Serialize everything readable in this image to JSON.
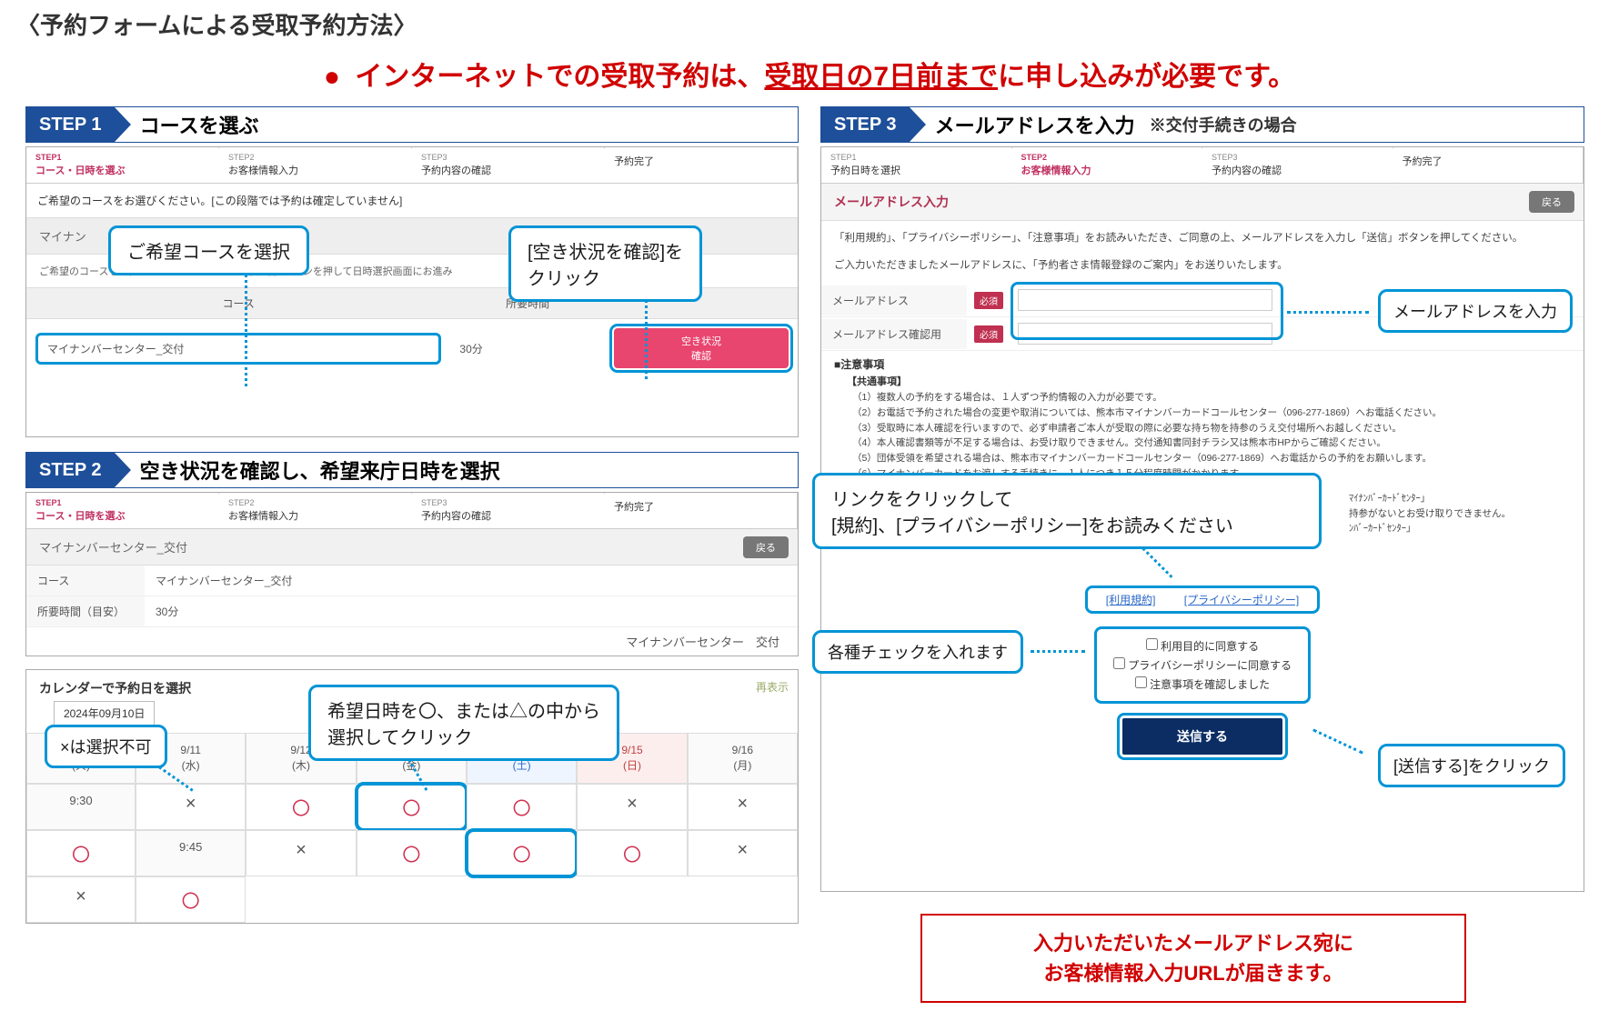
{
  "page_title": "〈予約フォームによる受取予約方法〉",
  "warning_prefix": "インターネットでの受取予約は、",
  "warning_underline": "受取日の7日前まで",
  "warning_suffix": "に申し込みが必要です。",
  "step1": {
    "badge": "STEP 1",
    "title": "コースを選ぶ",
    "crumbs": [
      {
        "small": "STEP1",
        "label": "コース・日時を選ぶ",
        "active": true
      },
      {
        "small": "STEP2",
        "label": "お客様情報入力",
        "active": false
      },
      {
        "small": "STEP3",
        "label": "予約内容の確認",
        "active": false
      },
      {
        "small": "",
        "label": "予約完了",
        "active": false
      }
    ],
    "instr": "ご希望のコースをお選びください。[この段階では予約は確定していません]",
    "tab_label": "マイナン",
    "course_instr": "ご希望のコースを選択していただき、「空き状況確認」ボタンを押して日時選択画面にお進み",
    "th_course": "コース",
    "th_time": "所要時間",
    "row_course": "マイナンバーセンター_交付",
    "row_time": "30分",
    "avail_btn_l1": "空き状況",
    "avail_btn_l2": "確認",
    "callout_course": "ご希望コースを選択",
    "callout_avail_l1": "[空き状況を確認]を",
    "callout_avail_l2": "クリック"
  },
  "step2": {
    "badge": "STEP 2",
    "title": "空き状況を確認し、希望来庁日時を選択",
    "crumbs": [
      {
        "small": "STEP1",
        "label": "コース・日時を選ぶ",
        "active": true
      },
      {
        "small": "STEP2",
        "label": "お客様情報入力",
        "active": false
      },
      {
        "small": "STEP3",
        "label": "予約内容の確認",
        "active": false
      },
      {
        "small": "",
        "label": "予約完了",
        "active": false
      }
    ],
    "subhead": "マイナンバーセンター_交付",
    "back": "戻る",
    "info_course_label": "コース",
    "info_course_value": "マイナンバーセンター_交付",
    "info_time_label": "所要時間（目安）",
    "info_time_value": "30分",
    "right_caption": "マイナンバーセンター　交付",
    "cal_title": "カレンダーで予約日を選択",
    "cal_date": "2024年09月10日",
    "redisplay": "再表示",
    "cal_head_blank": "(火)",
    "cal_heads": [
      {
        "d": "9/11",
        "w": "(水)",
        "cls": ""
      },
      {
        "d": "9/12",
        "w": "(木)",
        "cls": ""
      },
      {
        "d": "9/13",
        "w": "(金)",
        "cls": ""
      },
      {
        "d": "9/14",
        "w": "(土)",
        "cls": "sat"
      },
      {
        "d": "9/15",
        "w": "(日)",
        "cls": "sun"
      },
      {
        "d": "9/16",
        "w": "(月)",
        "cls": ""
      }
    ],
    "cal_times": [
      "9:30",
      "9:45"
    ],
    "cal_slots": [
      [
        "×",
        "〇",
        "〇",
        "〇",
        "×",
        "×",
        "〇"
      ],
      [
        "×",
        "〇",
        "〇",
        "〇",
        "×",
        "×",
        "〇"
      ]
    ],
    "callout_x": "×は選択不可",
    "callout_pick_l1": "希望日時を〇、または△の中から",
    "callout_pick_l2": "選択してクリック"
  },
  "step3": {
    "badge": "STEP 3",
    "title": "メールアドレスを入力",
    "note": "※交付手続きの場合",
    "crumbs": [
      {
        "small": "STEP1",
        "label": "予約日時を選択",
        "active": false
      },
      {
        "small": "STEP2",
        "label": "お客様情報入力",
        "active": true
      },
      {
        "small": "STEP3",
        "label": "予約内容の確認",
        "active": false
      },
      {
        "small": "",
        "label": "予約完了",
        "active": false
      }
    ],
    "email_head": "メールアドレス入力",
    "back": "戻る",
    "body1": "「利用規約」、「プライバシーポリシー」、「注意事項」をお読みいただき、ご同意の上、メールアドレスを入力し「送信」ボタンを押してください。",
    "body2": "ご入力いただきましたメールアドレスに、「予約者さま情報登録のご案内」をお送りいたします。",
    "f_email": "メールアドレス",
    "f_email2": "メールアドレス確認用",
    "req": "必須",
    "callout_email": "メールアドレスを入力",
    "notice_head": "■注意事項",
    "notice_sub": "【共通事項】",
    "notices": [
      "（1）複数人の予約をする場合は、１人ずつ予約情報の入力が必要です。",
      "（2）お電話で予約された場合の変更や取消については、熊本市マイナンバーカードコールセンター（096-277-1869）へお電話ください。",
      "（3）受取時に本人確認を行いますので、必ず申請者ご本人が受取の際に必要な持ち物を持参のうえ交付場所へお越しください。",
      "（4）本人確認書類等が不足する場合は、お受け取りできません。交付通知書同封チラシ又は熊本市HPからご確認ください。",
      "（5）団体受領を希望される場合は、熊本市マイナンバーカードコールセンター（096-277-1869）へお電話からの予約をお願いします。",
      "（6）マイナンバーカードをお渡しする手続きに、１人につき１５分程度時間がかかります"
    ],
    "hidden_lines": [
      "ﾏｲﾅﾝﾊﾞｰｶｰﾄﾞｾﾝﾀｰ」",
      "持参がないとお受け取りできません。",
      "ﾝﾊﾞｰｶｰﾄﾞｾﾝﾀｰ」"
    ],
    "link_terms": "[利用規約]",
    "link_privacy": "[プライバシーポリシー]",
    "chk1": "利用目的に同意する",
    "chk2": "プライバシーポリシーに同意する",
    "chk3": "注意事項を確認しました",
    "submit": "送信する",
    "callout_links_l1": "リンクをクリックして",
    "callout_links_l2": "[規約]、[プライバシーポリシー]をお読みください",
    "callout_checks": "各種チェックを入れます",
    "callout_submit": "[送信する]をクリック"
  },
  "final_l1": "入力いただいたメールアドレス宛に",
  "final_l2": "お客様情報入力URLが届きます。"
}
